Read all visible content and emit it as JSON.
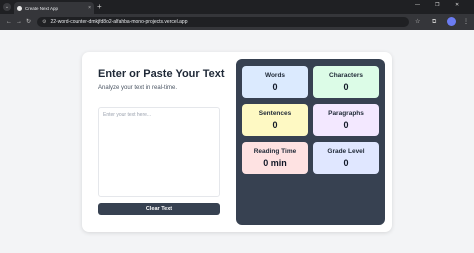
{
  "browser": {
    "tab_title": "Create Next App",
    "tab_close": "×",
    "new_tab": "+",
    "menu": "⌄",
    "url": "22-word-counter-dmkjfd8o2-alfahba-mono-projects.vercel.app",
    "window_controls": [
      "—",
      "❐",
      "✕"
    ],
    "nav": [
      "←",
      "→",
      "↻"
    ]
  },
  "editor": {
    "title": "Enter or Paste Your Text",
    "subtitle": "Analyze your text in real-time.",
    "placeholder": "Enter your text here...",
    "value": "",
    "clear_label": "Clear Text"
  },
  "stats": [
    {
      "label": "Words",
      "value": "0",
      "color": "#dbeafe"
    },
    {
      "label": "Characters",
      "value": "0",
      "color": "#dcfce7"
    },
    {
      "label": "Sentences",
      "value": "0",
      "color": "#fef9c3"
    },
    {
      "label": "Paragraphs",
      "value": "0",
      "color": "#f3e8ff"
    },
    {
      "label": "Reading Time",
      "value": "0 min",
      "color": "#fee2e2"
    },
    {
      "label": "Grade Level",
      "value": "0",
      "color": "#e0e7ff"
    }
  ],
  "colors": {
    "panel": "#374151",
    "button": "#374151",
    "page_bg": "#f3f4f6"
  }
}
